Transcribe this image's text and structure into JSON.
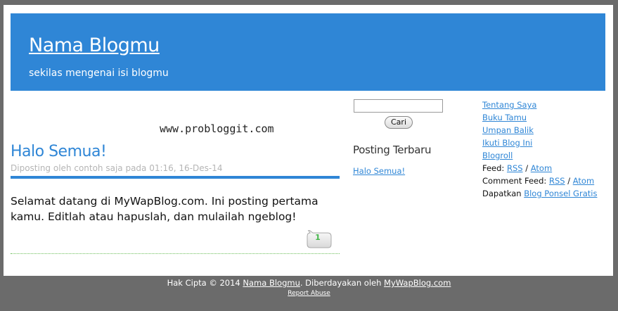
{
  "header": {
    "title": "Nama Blogmu",
    "description": "sekilas mengenai isi blogmu"
  },
  "watermark": "www.probloggit.com",
  "post": {
    "title": "Halo Semua!",
    "meta": "Diposting oleh contoh saja pada 01:16, 16-Des-14",
    "body": "Selamat datang di MyWapBlog.com. Ini posting pertama kamu. Editlah atau hapuslah, dan mulailah ngeblog!",
    "comment_count": "1"
  },
  "search": {
    "value": "",
    "button_label": "Cari"
  },
  "recent": {
    "heading": "Posting Terbaru",
    "items": [
      "Halo Semua!"
    ]
  },
  "sidebar": {
    "links": [
      "Tentang Saya",
      "Buku Tamu",
      "Umpan Balik",
      "Ikuti Blog Ini",
      "Blogroll"
    ],
    "feed_label": "Feed:",
    "feed_rss": "RSS",
    "feed_atom": "Atom",
    "comment_feed_label": "Comment Feed:",
    "comment_feed_rss": "RSS",
    "comment_feed_atom": "Atom",
    "separator": "/",
    "get_label": "Dapatkan",
    "get_link": "Blog Ponsel Gratis"
  },
  "footer": {
    "copyright_prefix": "Hak Cipta © 2014",
    "blog_link": "Nama Blogmu",
    "powered_text": ". Diberdayakan oleh",
    "powered_link": "MyWapBlog.com",
    "report": "Report Abuse"
  },
  "colors": {
    "accent": "#2f86d6",
    "background": "#6b6b6b",
    "comment_green": "#43b649"
  }
}
